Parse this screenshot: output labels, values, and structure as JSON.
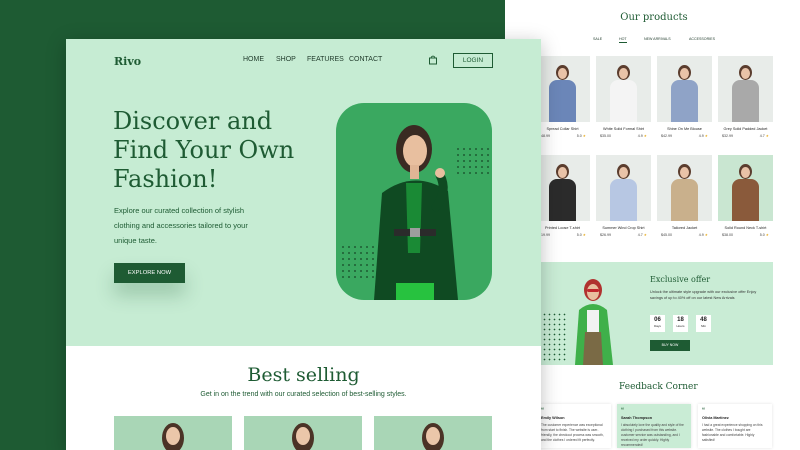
{
  "products_page": {
    "title": "Our products",
    "tabs": [
      "SALE",
      "HOT",
      "NEW ARRIVALS",
      "ACCESSORIES"
    ],
    "active_tab": "HOT",
    "items": [
      {
        "name": "Spread Collar Shirt",
        "price": "$48.99",
        "rating": "5.0"
      },
      {
        "name": "White Solid Formal Shirt",
        "price": "$35.00",
        "rating": "4.9"
      },
      {
        "name": "Shine On Me Blouse",
        "price": "$42.99",
        "rating": "4.9"
      },
      {
        "name": "Grey Solid Padded Jacket",
        "price": "$32.99",
        "rating": "4.7"
      },
      {
        "name": "Printed Loose T-shirt",
        "price": "$19.99",
        "rating": "5.0"
      },
      {
        "name": "Summer Wind Crop Shirt",
        "price": "$26.99",
        "rating": "4.7"
      },
      {
        "name": "Tailored Jacket",
        "price": "$45.00",
        "rating": "4.9"
      },
      {
        "name": "Solid Round Neck T-shirt",
        "price": "$38.00",
        "rating": "5.0"
      }
    ],
    "offer": {
      "title": "Exclusive offer",
      "text": "Unlock the ultimate style upgrade with our exclusive offer Enjoy savings of up to 40% off on our latest New Arrivals",
      "countdown": [
        {
          "value": "06",
          "unit": "Days"
        },
        {
          "value": "18",
          "unit": "Hours"
        },
        {
          "value": "48",
          "unit": "Min"
        }
      ],
      "button": "BUY NOW"
    },
    "feedback": {
      "title": "Feedback Corner",
      "cards": [
        {
          "name": "Emily Wilson",
          "text": "The customer experience was exceptional from start to finish. The website is user-friendly, the checkout process was smooth, and the clothes I ordered fit perfectly."
        },
        {
          "name": "Sarah Thompson",
          "text": "I absolutely love the quality and style of the clothing I purchased from this website. customer service was outstanding, and I received my order quickly. Highly recommended!"
        },
        {
          "name": "Olivia Martinez",
          "text": "I had a great experience shopping on this website. The clothes I bought are fashionable and comfortable. Highly satisfied!"
        }
      ]
    }
  },
  "front_page": {
    "logo": "Rivo",
    "nav": [
      "HOME",
      "SHOP",
      "FEATURES",
      "CONTACT"
    ],
    "login": "LOGIN",
    "hero_title": "Discover and Find Your Own Fashion!",
    "hero_subtitle": "Explore our curated collection of stylish clothing and accessories tailored to your unique taste.",
    "cta": "EXPLORE NOW",
    "best_selling_title": "Best selling",
    "best_selling_subtitle": "Get in on the trend with our curated selection of best-selling styles."
  },
  "colors": {
    "brand_dark": "#1e5b33",
    "mint": "#c6ecd3",
    "accent": "#3aa860"
  }
}
